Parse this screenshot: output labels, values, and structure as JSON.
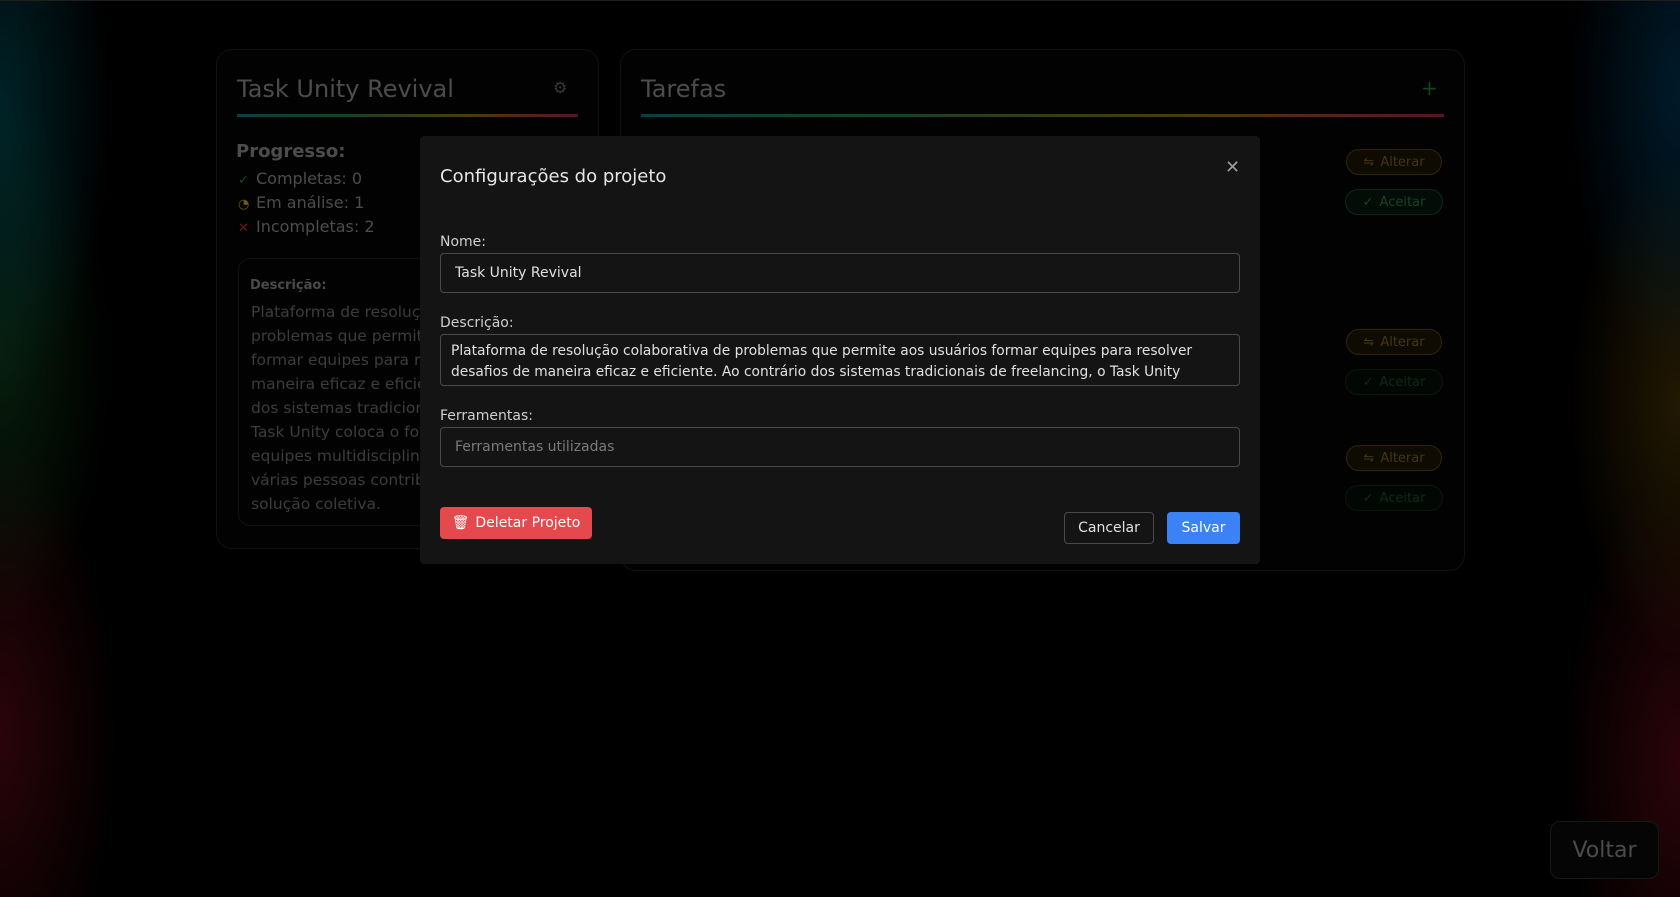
{
  "project_card": {
    "title": "Task Unity Revival",
    "settings_icon": "gear-icon",
    "progress_title": "Progresso:",
    "progress": [
      {
        "icon": "check-icon",
        "text": "Completas: 0",
        "color": "#3a8a3a"
      },
      {
        "icon": "clock-icon",
        "text": "Em análise: 1",
        "color": "#c9a227"
      },
      {
        "icon": "x-icon",
        "text": "Incompletas: 2",
        "color": "#c03030"
      }
    ],
    "description_label": "Descrição:",
    "description_lines": [
      "Plataforma de resoluçã",
      "problemas que permite",
      "formar equipes para re",
      "maneira eficaz e eficien",
      "dos sistemas tradiciona",
      "Task Unity coloca o foc",
      "equipes multidisciplinar",
      "várias pessoas contribu",
      "solução coletiva."
    ]
  },
  "tasks_card": {
    "title": "Tarefas",
    "add_icon": "plus-icon",
    "actions": [
      {
        "alterar": "Alterar",
        "aceitar": "Aceitar"
      },
      {
        "alterar": "Alterar",
        "aceitar": "Aceitar"
      },
      {
        "alterar": "Alterar",
        "aceitar": "Aceitar"
      }
    ]
  },
  "modal": {
    "title": "Configurações do projeto",
    "name_label": "Nome:",
    "name_value": "Task Unity Revival",
    "description_label": "Descrição:",
    "description_value": "Plataforma de resolução colaborativa de problemas que permite aos usuários formar equipes para resolver desafios de maneira eficaz e eficiente. Ao contrário dos sistemas tradicionais de freelancing, o Task Unity coloca o foco na",
    "tools_label": "Ferramentas:",
    "tools_placeholder": "Ferramentas utilizadas",
    "delete_label": "Deletar Projeto",
    "cancel_label": "Cancelar",
    "save_label": "Salvar"
  },
  "back_button": "Voltar",
  "colors": {
    "save": "#3b82f6",
    "delete": "#e5484d",
    "alterar": "#7e6220",
    "aceitar": "#2a7a45"
  }
}
